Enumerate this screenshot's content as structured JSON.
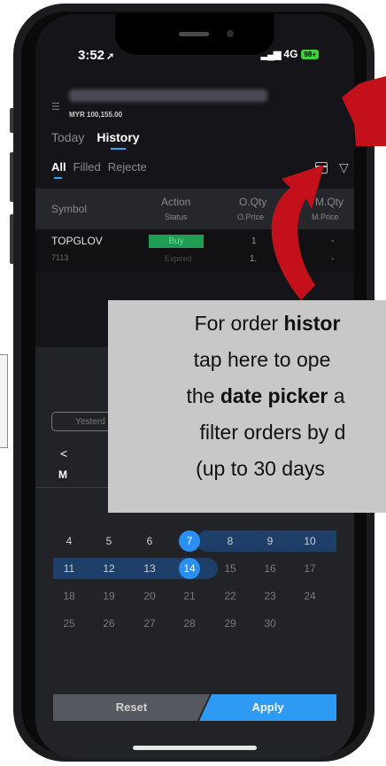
{
  "status_bar": {
    "time": "3:52",
    "network": "4G",
    "battery": "98+"
  },
  "account": {
    "balance": "MYR 100,155.00"
  },
  "tabs": {
    "today": "Today",
    "history": "History"
  },
  "sub_tabs": {
    "all": "All",
    "filled": "Filled",
    "rejected": "Rejecte"
  },
  "table": {
    "headers": {
      "symbol": "Symbol",
      "action": "Action",
      "action_sub": "Status",
      "oqty": "O.Qty",
      "oqty_sub": "O.Price",
      "mqty": "M.Qty",
      "mqty_sub": "M.Price"
    },
    "rows": [
      {
        "symbol": "TOPGLOV",
        "code": "7113",
        "action": "Buy",
        "status": "Expired",
        "oqty": "1",
        "oprice": "1.",
        "mqty": "-",
        "mprice": "-"
      }
    ]
  },
  "date_picker": {
    "quick_range": "Yesterd",
    "prev": "<",
    "weekday_visible": "M",
    "weeks": [
      [
        "4",
        "5",
        "6",
        "7",
        "8",
        "9",
        "10"
      ],
      [
        "11",
        "12",
        "13",
        "14",
        "15",
        "16",
        "17"
      ],
      [
        "18",
        "19",
        "20",
        "21",
        "22",
        "23",
        "24"
      ],
      [
        "25",
        "26",
        "27",
        "28",
        "29",
        "30",
        ""
      ]
    ],
    "range_start": "7",
    "range_end": "14",
    "reset": "Reset",
    "apply": "Apply"
  },
  "tooltip": {
    "l1_pre": "For order ",
    "l1_bold": "histor",
    "l2": "tap here to ope",
    "l3_pre": "the ",
    "l3_bold": "date picker",
    "l3_post": " a",
    "l4": "filter orders by d",
    "l5": "(up to 30 days"
  },
  "colors": {
    "accent": "#2b8ef3",
    "buy": "#1e9e55",
    "range": "#1e3f68",
    "arrow": "#c4101b"
  }
}
